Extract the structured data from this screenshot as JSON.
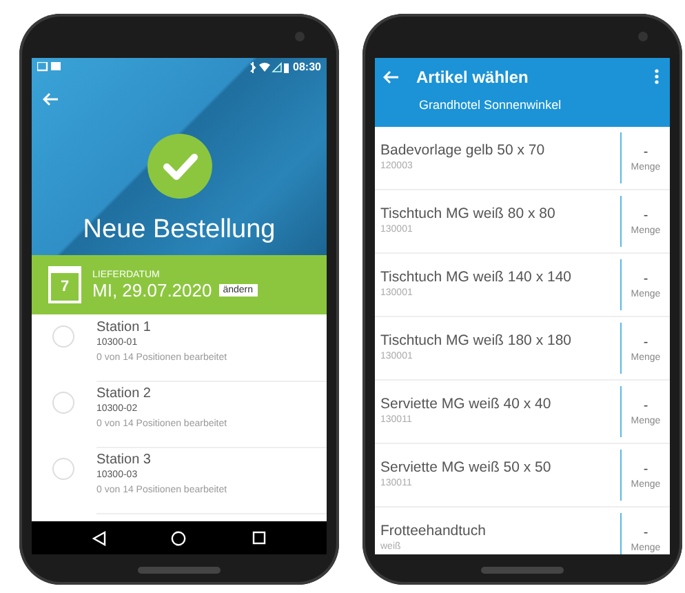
{
  "left_screen": {
    "status_bar": {
      "time": "08:30"
    },
    "title": "Neue Bestellung",
    "delivery": {
      "calendar_day": "7",
      "label": "LIEFERDATUM",
      "date": "MI, 29.07.2020",
      "button": "ändern"
    },
    "stations": [
      {
        "name": "Station 1",
        "code": "10300-01",
        "progress": "0 von 14 Positionen bearbeitet",
        "checked": false
      },
      {
        "name": "Station 2",
        "code": "10300-02",
        "progress": "0 von 14 Positionen bearbeitet",
        "checked": false
      },
      {
        "name": "Station 3",
        "code": "10300-03",
        "progress": "0 von 14 Positionen bearbeitet",
        "checked": false
      }
    ]
  },
  "right_screen": {
    "title": "Artikel wählen",
    "subtitle": "Grandhotel Sonnenwinkel",
    "articles": [
      {
        "name": "Badevorlage gelb 50 x 70",
        "number": "120003",
        "quantity": "-",
        "unit": "Menge"
      },
      {
        "name": "Tischtuch MG weiß 80 x 80",
        "number": "130001",
        "quantity": "-",
        "unit": "Menge"
      },
      {
        "name": "Tischtuch MG weiß 140 x 140",
        "number": "130001",
        "quantity": "-",
        "unit": "Menge"
      },
      {
        "name": "Tischtuch MG weiß 180 x 180",
        "number": "130001",
        "quantity": "-",
        "unit": "Menge"
      },
      {
        "name": "Serviette MG weiß 40 x 40",
        "number": "130011",
        "quantity": "-",
        "unit": "Menge"
      },
      {
        "name": "Serviette MG weiß 50 x 50",
        "number": "130011",
        "quantity": "-",
        "unit": "Menge"
      },
      {
        "name": "Frotteehandtuch",
        "number": "weiß",
        "quantity": "-",
        "unit": "Menge"
      }
    ]
  }
}
